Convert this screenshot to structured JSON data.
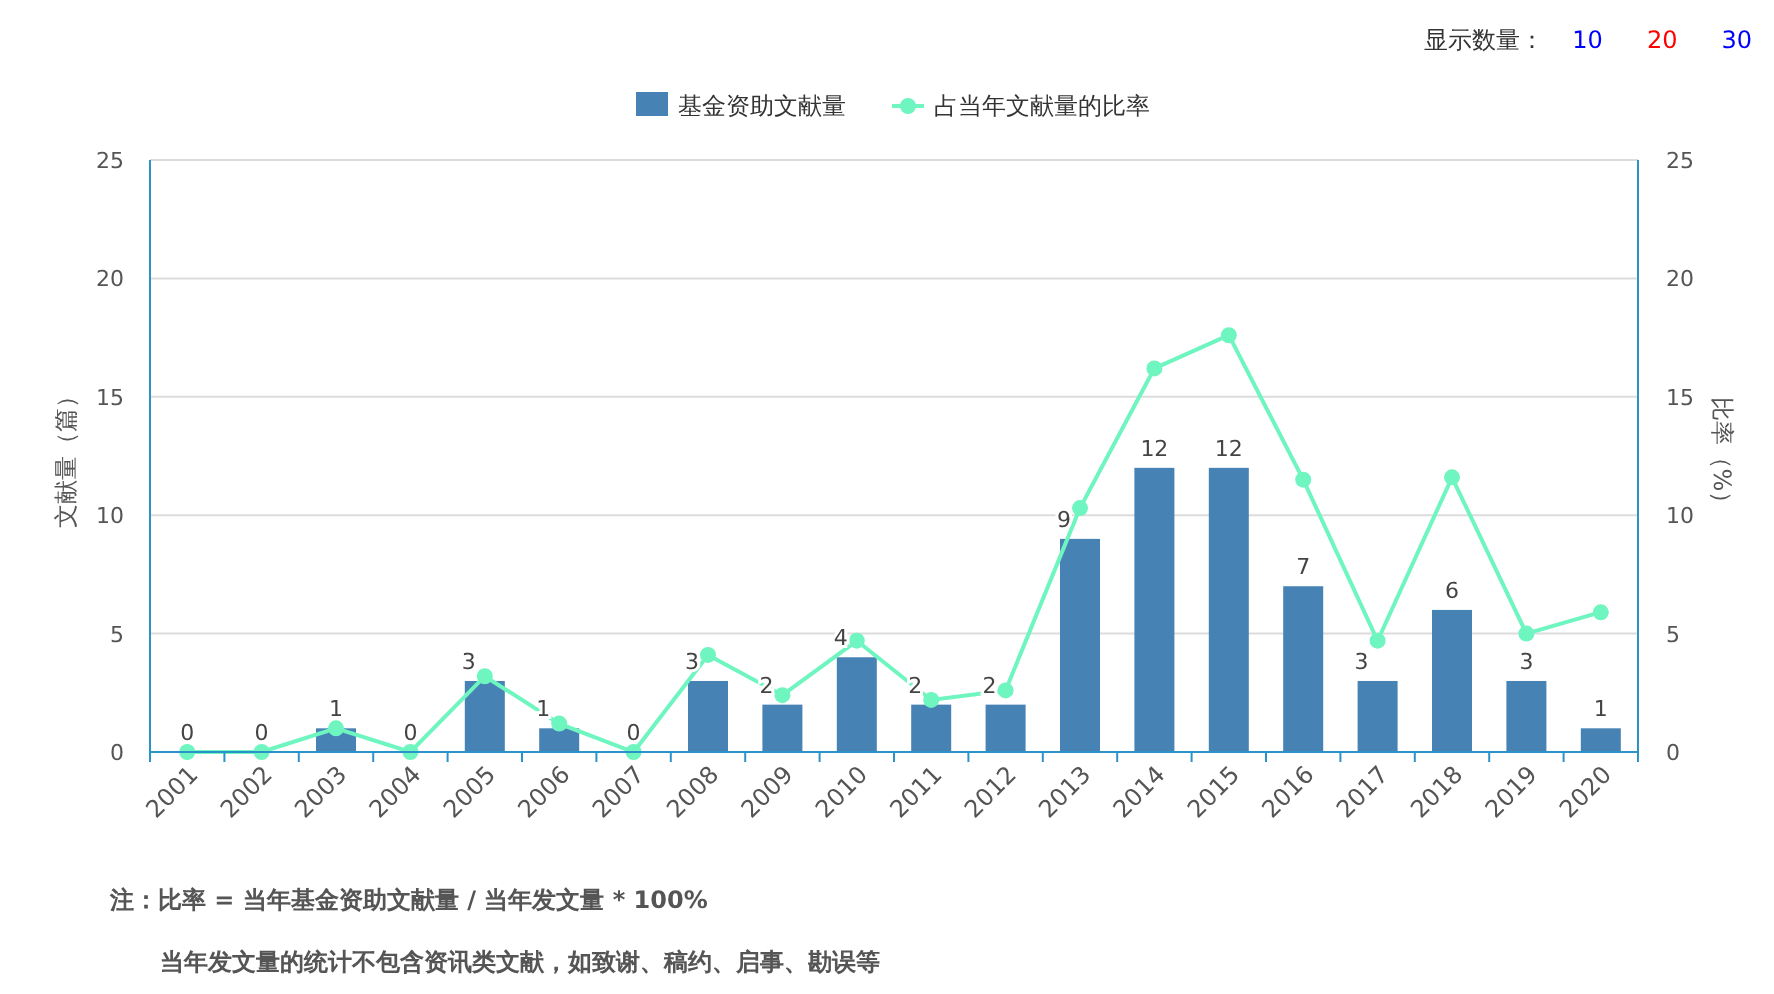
{
  "display_count": {
    "label": "显示数量：",
    "options": [
      {
        "label": "10",
        "selected": false
      },
      {
        "label": "20",
        "selected": true
      },
      {
        "label": "30",
        "selected": false
      }
    ]
  },
  "chart_data": {
    "type": "bar",
    "ylabel": "文献量（篇）",
    "y2label": "比率（%）",
    "categories": [
      "2001",
      "2002",
      "2003",
      "2004",
      "2005",
      "2006",
      "2007",
      "2008",
      "2009",
      "2010",
      "2011",
      "2012",
      "2013",
      "2014",
      "2015",
      "2016",
      "2017",
      "2018",
      "2019",
      "2020"
    ],
    "ylim": [
      0,
      25
    ],
    "yticks": [
      0,
      5,
      10,
      15,
      20,
      25
    ],
    "y2lim": [
      0,
      25
    ],
    "y2ticks": [
      0,
      5,
      10,
      15,
      20,
      25
    ],
    "grid": true,
    "legend": true,
    "series": [
      {
        "name": "基金资助文献量",
        "type": "bar",
        "color": "#4682b4",
        "values": [
          0,
          0,
          1,
          0,
          3,
          1,
          0,
          3,
          2,
          4,
          2,
          2,
          9,
          12,
          12,
          7,
          3,
          6,
          3,
          1
        ],
        "value_labels": [
          "0",
          "0",
          "1",
          "0",
          "3",
          "1",
          "0",
          "3",
          "2",
          "4",
          "2",
          "2",
          "9",
          "12",
          "12",
          "7",
          "3",
          "6",
          "3",
          "1"
        ]
      },
      {
        "name": "占当年文献量的比率",
        "type": "line",
        "marker": "circle",
        "color": "#6ff5c0",
        "values": [
          0,
          0,
          1.0,
          0,
          3.2,
          1.2,
          0,
          4.1,
          2.4,
          4.7,
          2.2,
          2.6,
          10.3,
          16.2,
          17.6,
          11.5,
          4.7,
          11.6,
          5.0,
          5.9
        ]
      }
    ]
  },
  "notes": [
    "注：比率 = 当年基金资助文献量 / 当年发文量 * 100%",
    "当年发文量的统计不包含资讯类文献，如致谢、稿约、启事、勘误等"
  ]
}
